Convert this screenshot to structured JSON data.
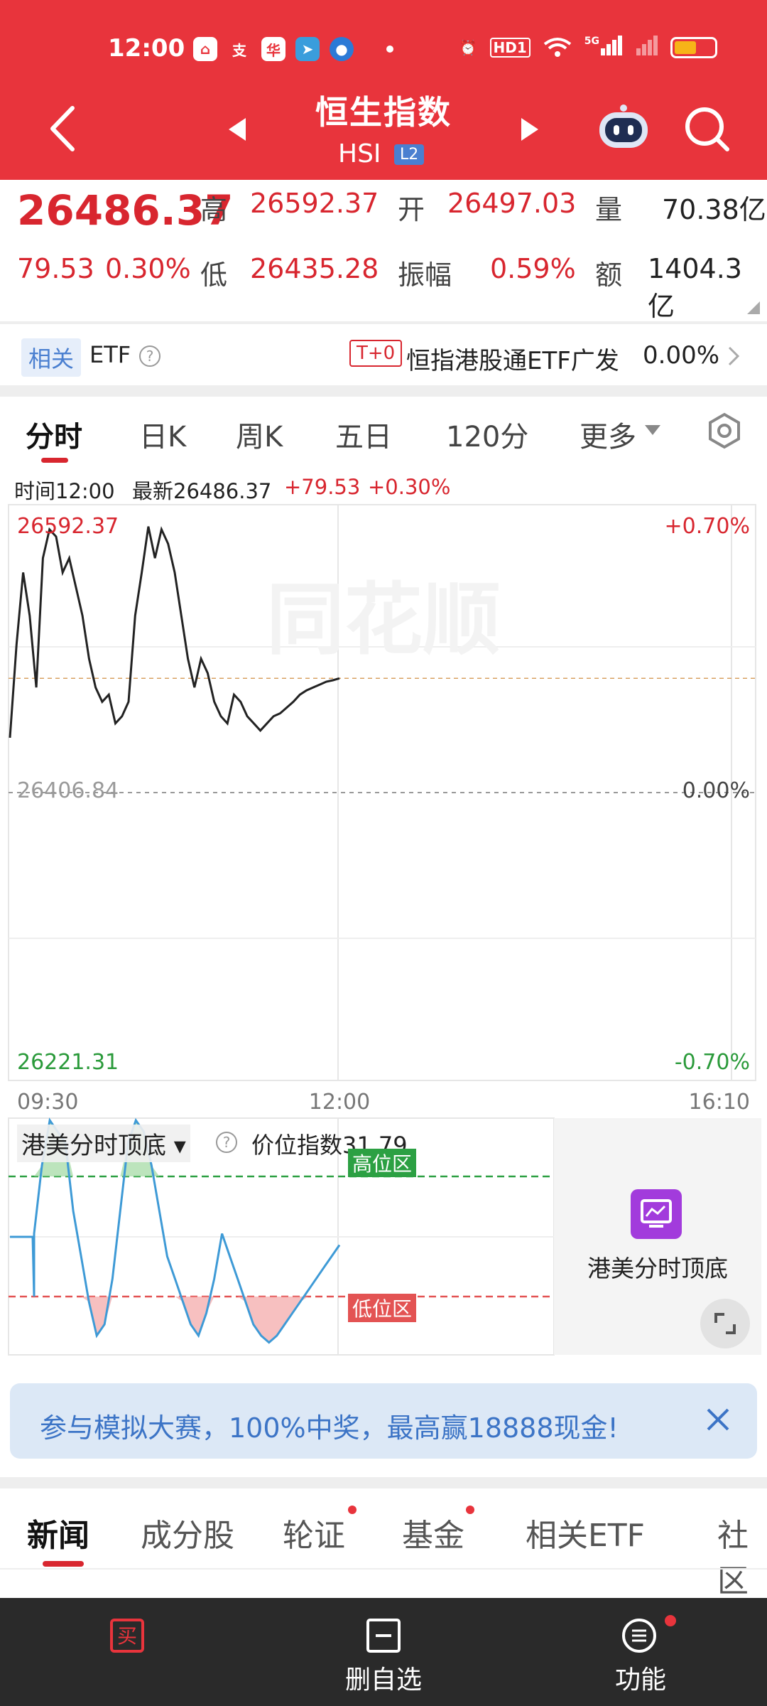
{
  "status_bar": {
    "time": "12:00",
    "icons": [
      "home-app-icon",
      "alipay-icon",
      "app-icon",
      "telegram-icon",
      "app-icon-2",
      "dot",
      "alarm-icon",
      "hd-icon",
      "wifi-icon",
      "5g-signal-icon",
      "signal-icon",
      "battery-icon"
    ],
    "hd_label": "HD1",
    "net_label": "5G"
  },
  "header": {
    "title": "恒生指数",
    "subtitle": "HSI",
    "badge": "L2",
    "color": "#e8343c"
  },
  "quote": {
    "price": "26486.37",
    "change": "79.53",
    "change_pct": "0.30%",
    "high_label": "高",
    "high": "26592.37",
    "open_label": "开",
    "open": "26497.03",
    "volume_label": "量",
    "volume": "70.38亿",
    "low_label": "低",
    "low": "26435.28",
    "amplitude_label": "振幅",
    "amplitude": "0.59%",
    "amount_label": "额",
    "amount": "1404.3亿"
  },
  "etf_row": {
    "tag": "相关",
    "label": "ETF",
    "t0": "T+0",
    "name": "恒指港股通ETF广发",
    "value": "0.00%"
  },
  "chart_tabs": [
    "分时",
    "日K",
    "周K",
    "五日",
    "120分",
    "更多"
  ],
  "info_line": {
    "time": "时间12:00",
    "latest": "最新26486.37",
    "change": "+79.53",
    "pct": "+0.30%"
  },
  "chart_labels": {
    "top_price": "26592.37",
    "mid_price": "26406.84",
    "bottom_price": "26221.31",
    "top_pct": "+0.70%",
    "mid_pct": "0.00%",
    "bottom_pct": "-0.70%",
    "time_start": "09:30",
    "time_mid": "12:00",
    "time_end": "16:10",
    "watermark": "同花顺"
  },
  "chart_data": {
    "type": "line",
    "title": "",
    "x_range": [
      "09:30",
      "16:10"
    ],
    "ylim": [
      26221.31,
      26592.37
    ],
    "baseline": 26406.84,
    "x": [
      0,
      1,
      2,
      3,
      4,
      5,
      6,
      7,
      8,
      9,
      10,
      11,
      12,
      13,
      14,
      15,
      16,
      17,
      18,
      19,
      20,
      21,
      22,
      23,
      24,
      25,
      26,
      27,
      28,
      29,
      30,
      31,
      32,
      33,
      34,
      35,
      36,
      37,
      38,
      39,
      40,
      41,
      42,
      43,
      44,
      45,
      46,
      47,
      48,
      49,
      50
    ],
    "values": [
      26445,
      26510,
      26560,
      26530,
      26480,
      26570,
      26590,
      26585,
      26560,
      26570,
      26550,
      26530,
      26500,
      26480,
      26470,
      26475,
      26455,
      26460,
      26470,
      26530,
      26560,
      26592,
      26570,
      26590,
      26580,
      26560,
      26530,
      26500,
      26480,
      26500,
      26490,
      26470,
      26460,
      26455,
      26475,
      26470,
      26460,
      26455,
      26450,
      26455,
      26460,
      26462,
      26466,
      26470,
      26475,
      26478,
      26480,
      26482,
      26484,
      26485,
      26486.37
    ],
    "indicator": {
      "name": "港美分时顶底",
      "index_label": "价位指数",
      "index_value": "31.79",
      "high_zone": "高位区",
      "low_zone": "低位区",
      "values": [
        50,
        80,
        100,
        95,
        90,
        60,
        40,
        20,
        5,
        10,
        30,
        60,
        90,
        100,
        95,
        80,
        60,
        40,
        30,
        20,
        10,
        5,
        15,
        30,
        50,
        40,
        30,
        20,
        10,
        5,
        2,
        5,
        10,
        15,
        20,
        25,
        30,
        35,
        40,
        45
      ]
    }
  },
  "indicator_panel": {
    "title": "港美分时顶底",
    "index_text": "价位指数31.79",
    "high_zone": "高位区",
    "low_zone": "低位区"
  },
  "side_ad": {
    "label": "港美分时顶底"
  },
  "banner": {
    "text": "参与模拟大赛，100%中奖，最高赢18888现金!"
  },
  "news_tabs": [
    "新闻",
    "成分股",
    "轮证",
    "基金",
    "相关ETF",
    "社区"
  ],
  "bottom_bar": {
    "buy_icon": "买",
    "remove_label": "删自选",
    "func_label": "功能"
  }
}
